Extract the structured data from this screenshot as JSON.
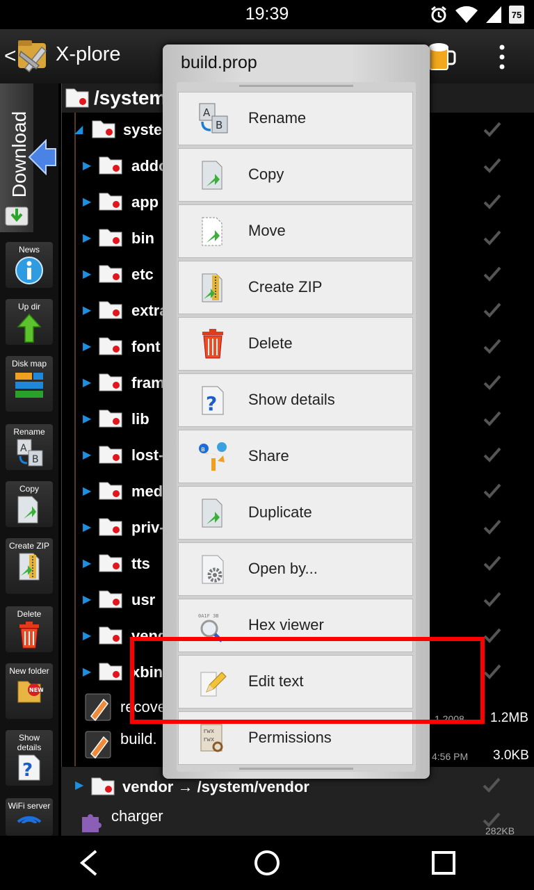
{
  "status_bar": {
    "time": "19:39",
    "battery": "75"
  },
  "app": {
    "title": "X-plore"
  },
  "sidebar": {
    "download_label": "Download",
    "tools": [
      {
        "label": "News",
        "icon": "info-icon"
      },
      {
        "label": "Up dir",
        "icon": "up-arrow-icon"
      },
      {
        "label": "Disk map",
        "icon": "disk-map-icon"
      },
      {
        "label": "Rename",
        "icon": "rename-icon"
      },
      {
        "label": "Copy",
        "icon": "copy-icon"
      },
      {
        "label": "Create ZIP",
        "icon": "zip-icon"
      },
      {
        "label": "Delete",
        "icon": "trash-icon"
      },
      {
        "label": "New folder",
        "icon": "new-folder-icon"
      },
      {
        "label": "Show details",
        "icon": "question-icon"
      },
      {
        "label": "WiFi server",
        "icon": "wifi-icon"
      }
    ]
  },
  "pane": {
    "path": "/system",
    "tree": [
      "syste",
      "addo",
      "app",
      "bin",
      "etc",
      "extra",
      "font",
      "fram",
      "lib",
      "lost-",
      "med",
      "priv-",
      "tts",
      "usr",
      "vend",
      "xbin"
    ],
    "files": [
      {
        "name": "recove",
        "meta": "1 2008",
        "size": "1.2MB"
      },
      {
        "name": "build.",
        "meta": "4:56 PM",
        "size": "3.0KB"
      }
    ]
  },
  "lower": {
    "vendor_link": "vendor → /system/vendor",
    "charger": "charger",
    "charger_size": "282KB"
  },
  "dialog": {
    "title": "build.prop",
    "items": [
      {
        "label": "Rename",
        "icon": "rename-icon"
      },
      {
        "label": "Copy",
        "icon": "copy-icon"
      },
      {
        "label": "Move",
        "icon": "move-icon"
      },
      {
        "label": "Create ZIP",
        "icon": "zip-icon"
      },
      {
        "label": "Delete",
        "icon": "trash-icon"
      },
      {
        "label": "Show details",
        "icon": "question-icon"
      },
      {
        "label": "Share",
        "icon": "share-icon"
      },
      {
        "label": "Duplicate",
        "icon": "duplicate-icon"
      },
      {
        "label": "Open by...",
        "icon": "gear-icon"
      },
      {
        "label": "Hex viewer",
        "icon": "magnifier-icon"
      },
      {
        "label": "Edit text",
        "icon": "pencil-icon"
      },
      {
        "label": "Permissions",
        "icon": "permissions-icon"
      }
    ]
  },
  "colors": {
    "accent_blue": "#1b8fe0",
    "highlight": "#ff0000",
    "folder_red": "#e0161c"
  }
}
